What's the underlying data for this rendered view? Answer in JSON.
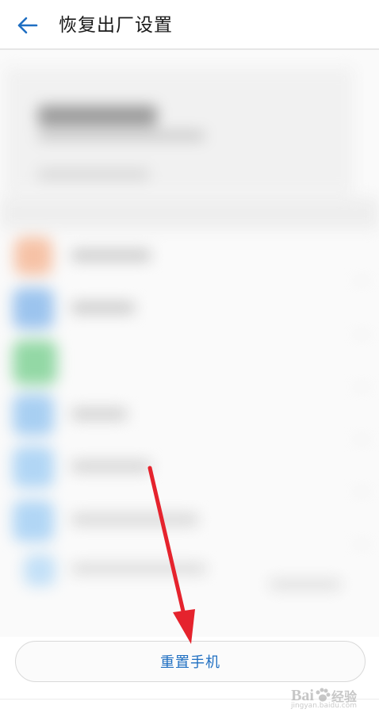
{
  "header": {
    "title": "恢复出厂设置",
    "back_icon": "arrow-left-icon"
  },
  "actions": {
    "reset_label": "重置手机"
  },
  "watermark": {
    "brand": "Bai",
    "brand_tail": "经验",
    "sub": "jingyan.baidu.com"
  },
  "colors": {
    "accent": "#1f6fc2",
    "annotation": "#e5232d"
  }
}
